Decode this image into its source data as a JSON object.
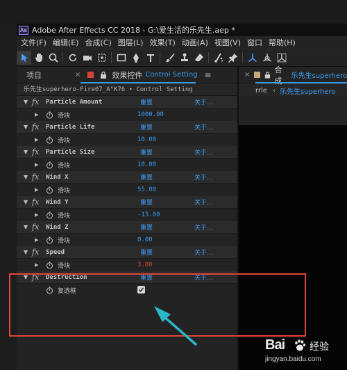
{
  "window": {
    "title": "Adobe After Effects CC 2018 - G:\\爱生活的乐先生.aep *",
    "app_icon": "Ae"
  },
  "menu": [
    "文件(F)",
    "编辑(E)",
    "合成(C)",
    "图层(L)",
    "效果(T)",
    "动画(A)",
    "视图(V)",
    "窗口",
    "帮助(H)"
  ],
  "toolbar": {
    "tools": [
      "selection-arrow",
      "hand",
      "zoom",
      "rotate",
      "camera",
      "pan-behind",
      "rectangle",
      "pen",
      "text",
      "brush",
      "clone-stamp",
      "eraser",
      "roto-brush",
      "puppet-pin",
      "axis-local",
      "axis-world",
      "axis-view"
    ]
  },
  "left_panel": {
    "tab_project": "项目",
    "tab_close": "×",
    "tab_effects": "效果控件",
    "tab_effects_en": "Control Setting",
    "header": "乐先生superhero-Fire07_A\"K76 • Control Setting",
    "effects": [
      {
        "name": "Particle Amount",
        "reset": "重置",
        "about": "关于...",
        "sub_label": "滑块",
        "value": "1000.00",
        "value_color": "blue"
      },
      {
        "name": "Particle Life",
        "reset": "重置",
        "about": "关于...",
        "sub_label": "滑块",
        "value": "10.00",
        "value_color": "blue"
      },
      {
        "name": "Particle Size",
        "reset": "重置",
        "about": "关于...",
        "sub_label": "滑块",
        "value": "10.00",
        "value_color": "blue"
      },
      {
        "name": "Wind X",
        "reset": "重置",
        "about": "关于...",
        "sub_label": "滑块",
        "value": "55.00",
        "value_color": "blue"
      },
      {
        "name": "Wind Y",
        "reset": "重置",
        "about": "关于...",
        "sub_label": "滑块",
        "value": "-15.00",
        "value_color": "blue"
      },
      {
        "name": "Wind Z",
        "reset": "重置",
        "about": "关于...",
        "sub_label": "滑块",
        "value": "0.00",
        "value_color": "blue"
      },
      {
        "name": "Speed",
        "reset": "重置",
        "about": "关于...",
        "sub_label": "滑块",
        "value": "3.00",
        "value_color": "red"
      },
      {
        "name": "Destruction",
        "reset": "重置",
        "about": "关于...",
        "sub_label": "复选框",
        "checked": true
      }
    ]
  },
  "right_panel": {
    "tab_close": "×",
    "tab_comp": "合成",
    "comp_name": "乐先生superhero",
    "breadcrumb_layer": "rrle",
    "breadcrumb_comp": "乐先生superhero"
  },
  "annotation": {
    "highlight_color": "#e0433b",
    "arrow_color": "#2bb7c9"
  },
  "watermark": {
    "logo_text": "Bai",
    "logo_suffix": "经验",
    "url": "jingyan.baidu.com"
  },
  "colors": {
    "accent": "#3c9bf0",
    "value_red": "#e0433b"
  }
}
